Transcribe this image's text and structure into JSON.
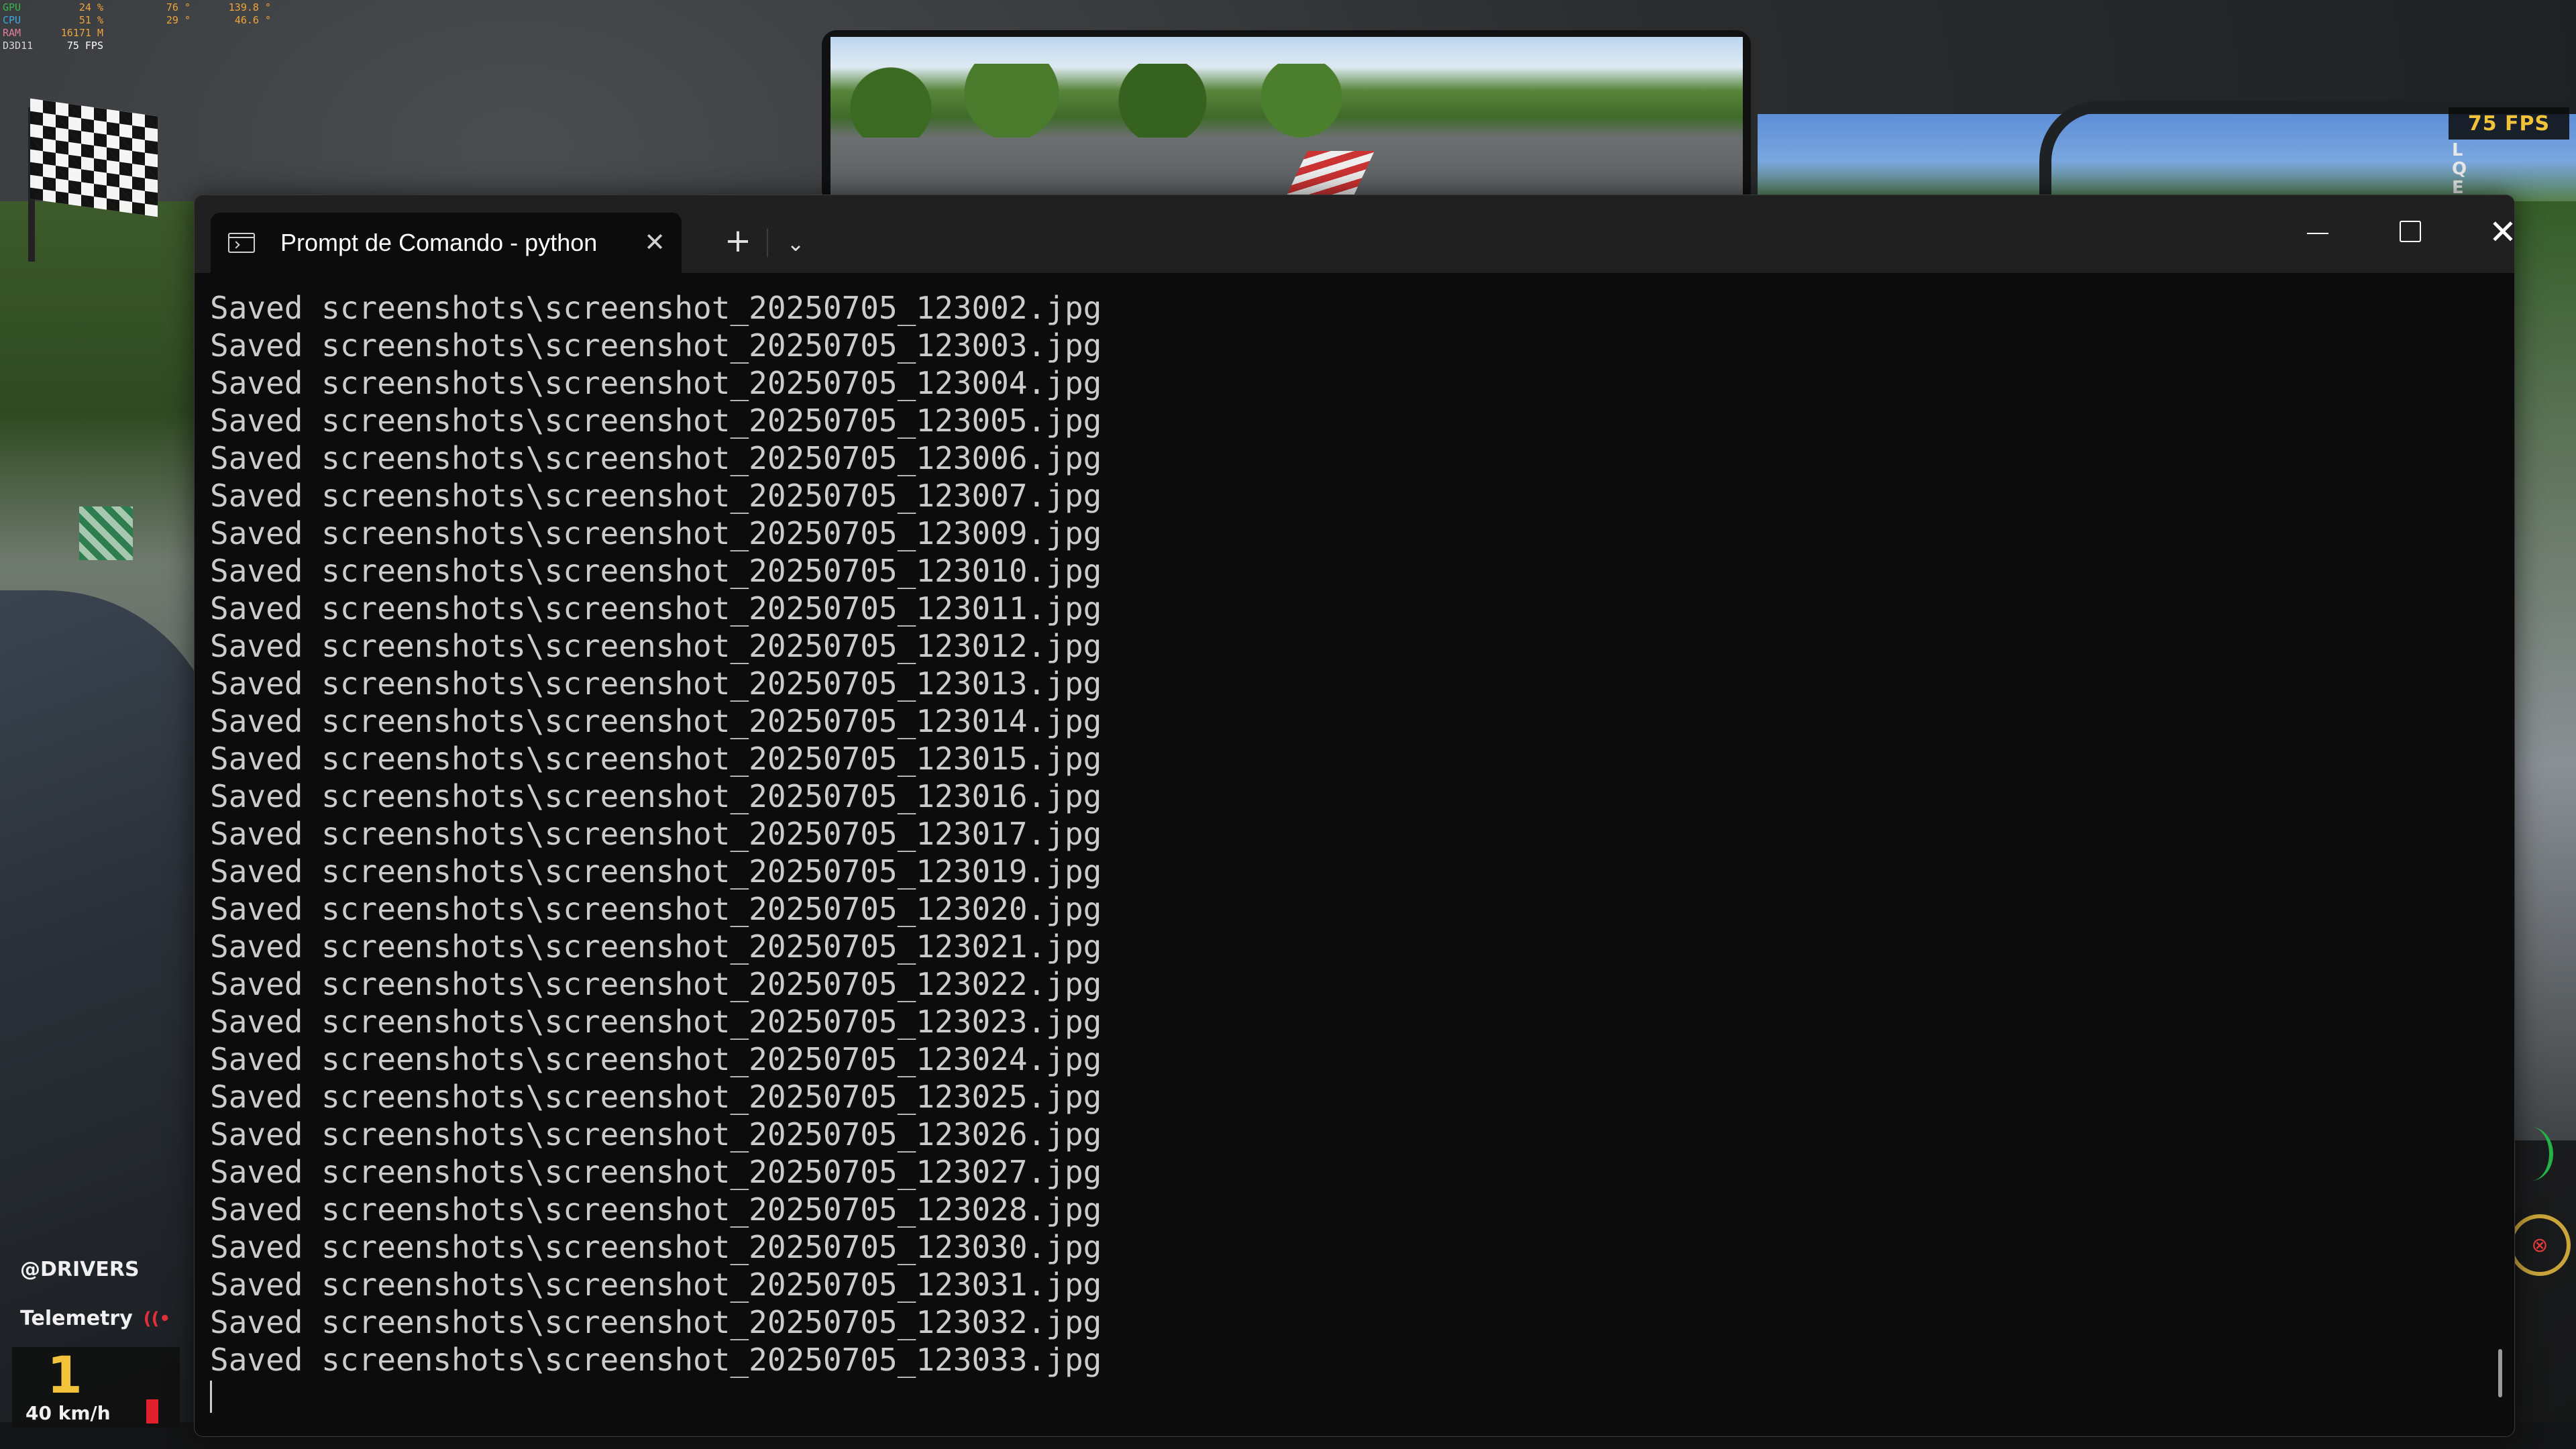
{
  "overlay": {
    "gpu": {
      "label": "GPU",
      "v1": "24 %",
      "v2": "76 °",
      "v3": "139.8 °"
    },
    "cpu": {
      "label": "CPU",
      "v1": "51 %",
      "v2": "29 °",
      "v3": "46.6 °"
    },
    "ram": {
      "label": "RAM",
      "v1": "16171 M"
    },
    "api": {
      "label": "D3D11",
      "v1": "75 FPS"
    },
    "fps_badge": "75 FPS",
    "side_letters": [
      "L",
      "Q",
      "E"
    ],
    "drivers_label": "@DRIVERS",
    "telemetry_label": "Telemetry",
    "gear": "1",
    "speed": "40 km/h",
    "colors": {
      "accent": "#f2c23a",
      "alert": "#e0303a"
    }
  },
  "terminal": {
    "tab_title": "Prompt de Comando - python",
    "tab_icon": "terminal-icon",
    "new_tab_label": "+",
    "dropdown_label": "⌄",
    "controls": {
      "minimize": "minimize-icon",
      "maximize": "maximize-icon",
      "close": "close-icon"
    },
    "lines": [
      "Saved screenshots\\screenshot_20250705_123002.jpg",
      "Saved screenshots\\screenshot_20250705_123003.jpg",
      "Saved screenshots\\screenshot_20250705_123004.jpg",
      "Saved screenshots\\screenshot_20250705_123005.jpg",
      "Saved screenshots\\screenshot_20250705_123006.jpg",
      "Saved screenshots\\screenshot_20250705_123007.jpg",
      "Saved screenshots\\screenshot_20250705_123009.jpg",
      "Saved screenshots\\screenshot_20250705_123010.jpg",
      "Saved screenshots\\screenshot_20250705_123011.jpg",
      "Saved screenshots\\screenshot_20250705_123012.jpg",
      "Saved screenshots\\screenshot_20250705_123013.jpg",
      "Saved screenshots\\screenshot_20250705_123014.jpg",
      "Saved screenshots\\screenshot_20250705_123015.jpg",
      "Saved screenshots\\screenshot_20250705_123016.jpg",
      "Saved screenshots\\screenshot_20250705_123017.jpg",
      "Saved screenshots\\screenshot_20250705_123019.jpg",
      "Saved screenshots\\screenshot_20250705_123020.jpg",
      "Saved screenshots\\screenshot_20250705_123021.jpg",
      "Saved screenshots\\screenshot_20250705_123022.jpg",
      "Saved screenshots\\screenshot_20250705_123023.jpg",
      "Saved screenshots\\screenshot_20250705_123024.jpg",
      "Saved screenshots\\screenshot_20250705_123025.jpg",
      "Saved screenshots\\screenshot_20250705_123026.jpg",
      "Saved screenshots\\screenshot_20250705_123027.jpg",
      "Saved screenshots\\screenshot_20250705_123028.jpg",
      "Saved screenshots\\screenshot_20250705_123030.jpg",
      "Saved screenshots\\screenshot_20250705_123031.jpg",
      "Saved screenshots\\screenshot_20250705_123032.jpg",
      "Saved screenshots\\screenshot_20250705_123033.jpg"
    ]
  }
}
